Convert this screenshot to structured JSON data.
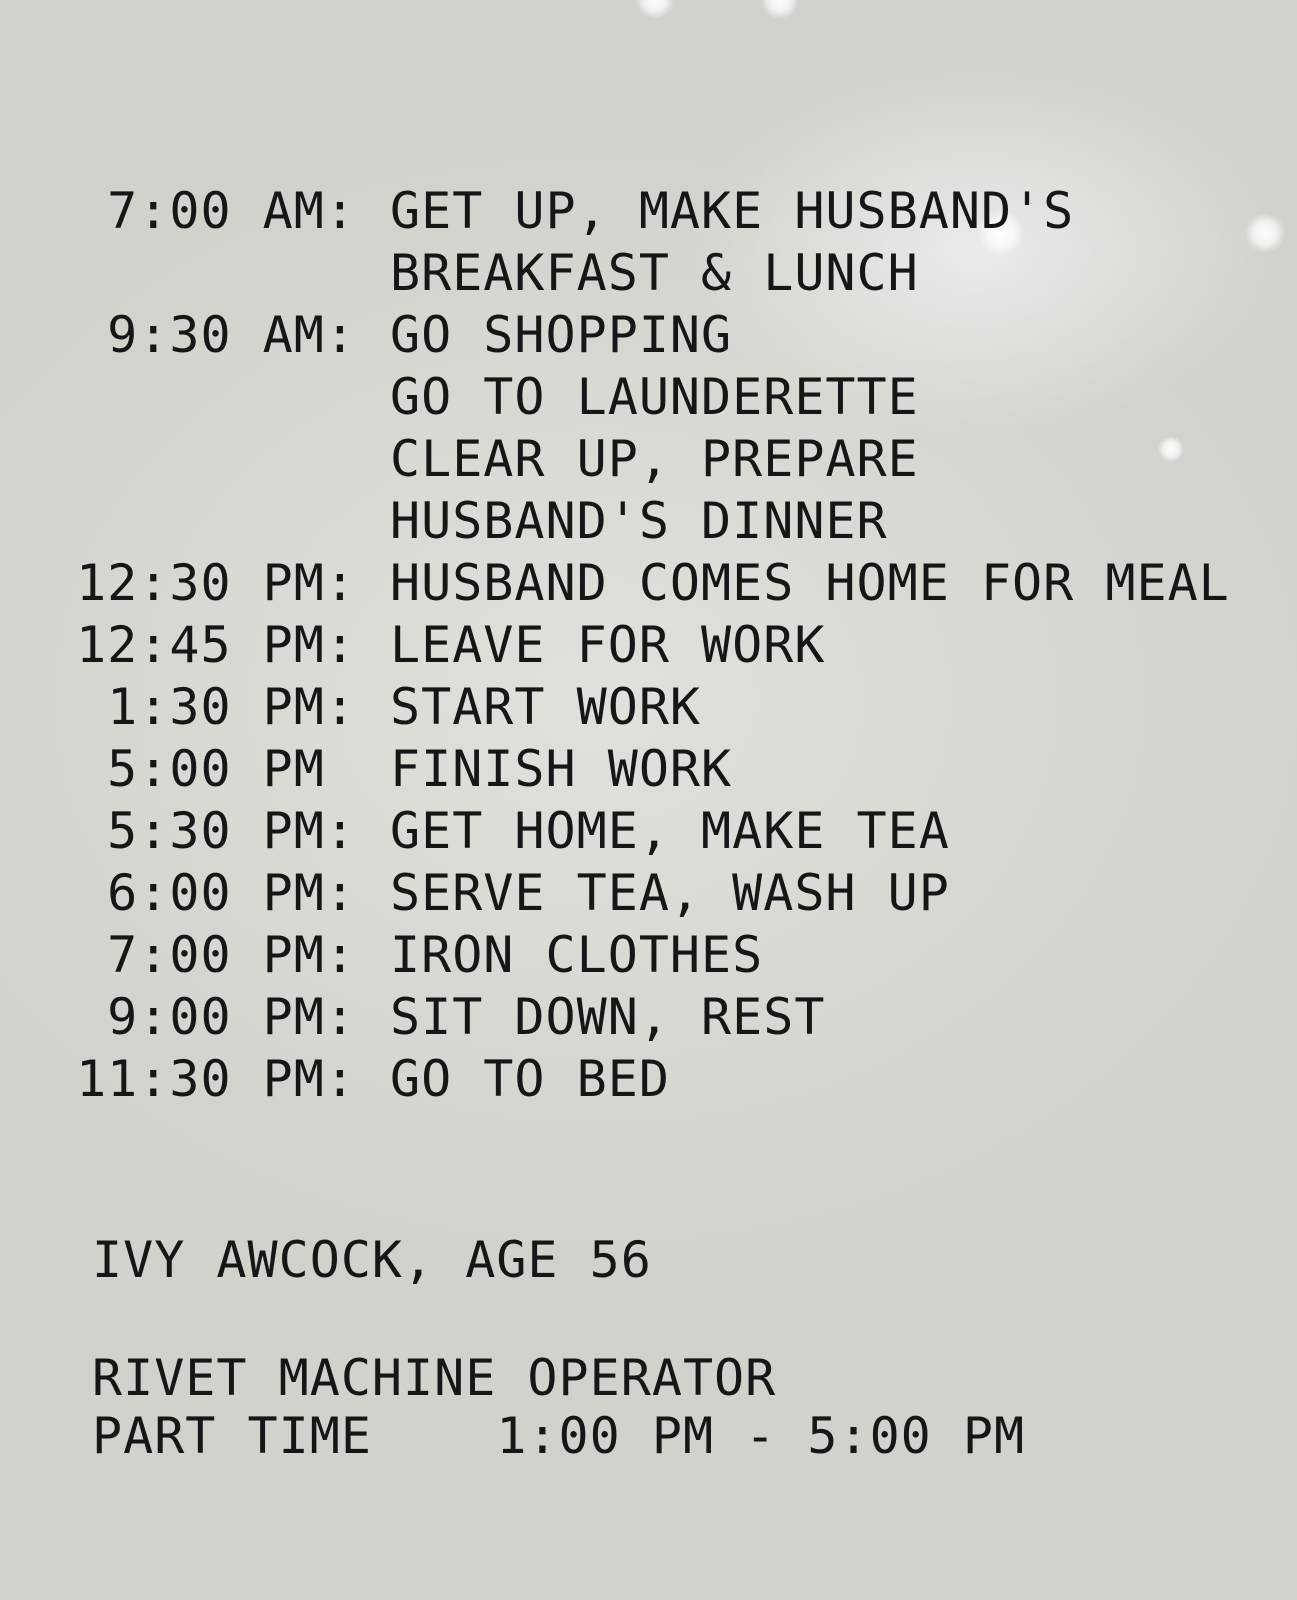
{
  "schedule": [
    {
      "time": "7:00 AM:",
      "task": "GET UP, MAKE HUSBAND'S"
    },
    {
      "time": "",
      "task": "BREAKFAST & LUNCH"
    },
    {
      "time": "9:30 AM:",
      "task": "GO SHOPPING"
    },
    {
      "time": "",
      "task": "GO TO LAUNDERETTE"
    },
    {
      "time": "",
      "task": "CLEAR UP, PREPARE"
    },
    {
      "time": "",
      "task": "HUSBAND'S DINNER"
    },
    {
      "time": "12:30 PM:",
      "task": "HUSBAND COMES HOME FOR MEAL"
    },
    {
      "time": "12:45 PM:",
      "task": "LEAVE FOR WORK"
    },
    {
      "time": "1:30 PM:",
      "task": "START WORK"
    },
    {
      "time": "5:00 PM ",
      "task": "FINISH WORK"
    },
    {
      "time": "5:30 PM:",
      "task": "GET HOME, MAKE TEA"
    },
    {
      "time": "6:00 PM:",
      "task": "SERVE TEA, WASH UP"
    },
    {
      "time": "7:00 PM:",
      "task": "IRON CLOTHES"
    },
    {
      "time": "9:00 PM:",
      "task": "SIT DOWN, REST"
    },
    {
      "time": "11:30 PM:",
      "task": "GO TO BED"
    }
  ],
  "footer": {
    "name": "IVY AWCOCK, AGE 56",
    "job": "RIVET MACHINE OPERATOR",
    "hours": "PART TIME    1:00 PM - 5:00 PM"
  }
}
